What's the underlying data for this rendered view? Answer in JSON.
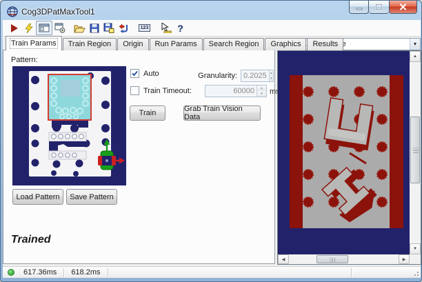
{
  "window": {
    "title": "Cog3DPatMaxTool1"
  },
  "toolbar": {
    "icons": [
      "run",
      "electric-run",
      "show-image-pane",
      "float-pane",
      "open-file",
      "save-file",
      "save-as",
      "reset",
      "show-values",
      "pointer-measure",
      "help"
    ],
    "values_icon_text": "123"
  },
  "tabs": {
    "items": [
      {
        "label": "Train Params",
        "active": true
      },
      {
        "label": "Train Region",
        "active": false
      },
      {
        "label": "Origin",
        "active": false
      },
      {
        "label": "Run Params",
        "active": false
      },
      {
        "label": "Search Region",
        "active": false
      },
      {
        "label": "Graphics",
        "active": false
      },
      {
        "label": "Results",
        "active": false
      }
    ]
  },
  "train_params": {
    "pattern_label": "Pattern:",
    "load_pattern_button": "Load Pattern",
    "save_pattern_button": "Save Pattern",
    "auto_checkbox": {
      "label": "Auto",
      "checked": true
    },
    "granularity": {
      "label": "Granularity:",
      "value": "0.2025",
      "enabled": false
    },
    "train_timeout": {
      "label": "Train Timeout:",
      "checked": false,
      "value": "60000",
      "unit": "ms",
      "enabled": false
    },
    "train_button": "Train",
    "grab_button": "Grab Train Vision Data",
    "status_text": "Trained"
  },
  "image_panel": {
    "source_dropdown": {
      "selected": "Current.InputImage"
    }
  },
  "status_bar": {
    "run_indicator_color": "#37ac37",
    "tool_time": "617.36ms",
    "total_time": "618.2ms"
  },
  "icons": {
    "spinner_up": "▲",
    "spinner_down": "▼",
    "scroll_up": "▲",
    "scroll_down": "▼",
    "scroll_left": "◀",
    "scroll_right": "▶",
    "combo_arrow": "▼",
    "help_glyph": "?"
  },
  "colors": {
    "navy_background": "#23236B",
    "maroon_red": "#8B130B",
    "plate_gray": "#ABABAB",
    "pattern_cyan": "#8ED8DC",
    "train_region_red": "#D43B30",
    "titlebar_blue": "#B9D4EE",
    "status_green": "#37AC37"
  }
}
